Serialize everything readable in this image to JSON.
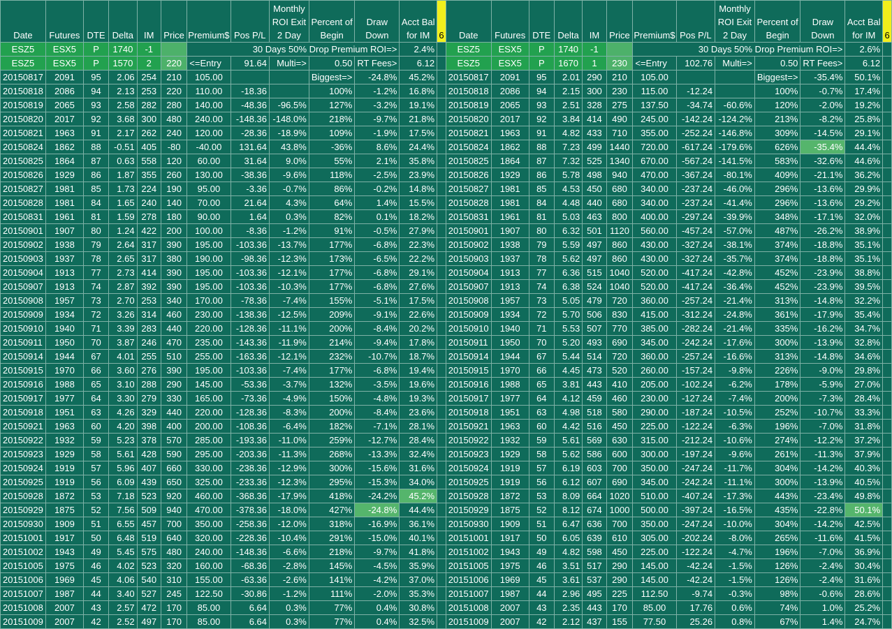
{
  "headers": [
    "Date",
    "Futures",
    "DTE",
    "Delta",
    "IM",
    "Price",
    "Premium$",
    "Pos P/L",
    "Monthly ROI Exit 2 Day",
    "Percent of Begin",
    "Draw Down",
    "Acct Bal for IM"
  ],
  "marker": "6",
  "left": {
    "row1": {
      "date": "ESZ5",
      "fut": "ESX5",
      "dte": "P",
      "delta": "1740",
      "im": "-1",
      "label": "30 Days 50% Drop Premium ROI=>",
      "roi": "2.4%"
    },
    "row2": {
      "date": "ESZ5",
      "fut": "ESX5",
      "dte": "P",
      "delta": "1570",
      "im": "2",
      "price": "220",
      "entry": "<=Entry",
      "pnl": "91.64",
      "multi": "Multi=>",
      "mval": "0.50",
      "fees": "RT Fees>",
      "fval": "6.12"
    }
  },
  "right": {
    "row1": {
      "date": "ESZ5",
      "fut": "ESX5",
      "dte": "P",
      "delta": "1740",
      "im": "-1",
      "label": "30 Days 50% Drop Premium ROI=>",
      "roi": "2.6%"
    },
    "row2": {
      "date": "ESZ5",
      "fut": "ESX5",
      "dte": "P",
      "delta": "1670",
      "im": "1",
      "price": "230",
      "entry": "<=Entry",
      "pnl": "102.76",
      "multi": "Multi=>",
      "mval": "0.50",
      "fees": "RT Fees>",
      "fval": "6.12"
    }
  },
  "rows": [
    {
      "d": "20150817",
      "f": "2091",
      "dte": "95",
      "L": [
        "2.06",
        "254",
        "210",
        "105.00",
        "",
        "",
        "Biggest=>",
        "-24.8%",
        "45.2%"
      ],
      "R": [
        "2.01",
        "290",
        "210",
        "105.00",
        "",
        "",
        "Biggest=>",
        "-35.4%",
        "50.1%"
      ]
    },
    {
      "d": "20150818",
      "f": "2086",
      "dte": "94",
      "L": [
        "2.13",
        "253",
        "220",
        "110.00",
        "-18.36",
        "",
        "100%",
        "-1.2%",
        "16.8%"
      ],
      "R": [
        "2.15",
        "300",
        "230",
        "115.00",
        "-12.24",
        "",
        "100%",
        "-0.7%",
        "17.4%"
      ]
    },
    {
      "d": "20150819",
      "f": "2065",
      "dte": "93",
      "L": [
        "2.58",
        "282",
        "280",
        "140.00",
        "-48.36",
        "-96.5%",
        "127%",
        "-3.2%",
        "19.1%"
      ],
      "R": [
        "2.51",
        "328",
        "275",
        "137.50",
        "-34.74",
        "-60.6%",
        "120%",
        "-2.0%",
        "19.2%"
      ]
    },
    {
      "d": "20150820",
      "f": "2017",
      "dte": "92",
      "L": [
        "3.68",
        "300",
        "480",
        "240.00",
        "-148.36",
        "-148.0%",
        "218%",
        "-9.7%",
        "21.8%"
      ],
      "R": [
        "3.84",
        "414",
        "490",
        "245.00",
        "-142.24",
        "-124.2%",
        "213%",
        "-8.2%",
        "25.8%"
      ]
    },
    {
      "d": "20150821",
      "f": "1963",
      "dte": "91",
      "L": [
        "2.17",
        "262",
        "240",
        "120.00",
        "-28.36",
        "-18.9%",
        "109%",
        "-1.9%",
        "17.5%"
      ],
      "R": [
        "4.82",
        "433",
        "710",
        "355.00",
        "-252.24",
        "-146.8%",
        "309%",
        "-14.5%",
        "29.1%"
      ]
    },
    {
      "d": "20150824",
      "f": "1862",
      "dte": "88",
      "L": [
        "-0.51",
        "405",
        "-80",
        "-40.00",
        "131.64",
        "43.8%",
        "-36%",
        "8.6%",
        "24.4%"
      ],
      "R": [
        "7.23",
        "499",
        "1440",
        "720.00",
        "-617.24",
        "-179.6%",
        "626%",
        "-35.4%",
        "44.4%"
      ]
    },
    {
      "d": "20150825",
      "f": "1864",
      "dte": "87",
      "L": [
        "0.63",
        "558",
        "120",
        "60.00",
        "31.64",
        "9.0%",
        "55%",
        "2.1%",
        "35.8%"
      ],
      "R": [
        "7.32",
        "525",
        "1340",
        "670.00",
        "-567.24",
        "-141.5%",
        "583%",
        "-32.6%",
        "44.6%"
      ]
    },
    {
      "d": "20150826",
      "f": "1929",
      "dte": "86",
      "L": [
        "1.87",
        "355",
        "260",
        "130.00",
        "-38.36",
        "-9.6%",
        "118%",
        "-2.5%",
        "23.9%"
      ],
      "R": [
        "5.78",
        "498",
        "940",
        "470.00",
        "-367.24",
        "-80.1%",
        "409%",
        "-21.1%",
        "36.2%"
      ]
    },
    {
      "d": "20150827",
      "f": "1981",
      "dte": "85",
      "L": [
        "1.73",
        "224",
        "190",
        "95.00",
        "-3.36",
        "-0.7%",
        "86%",
        "-0.2%",
        "14.8%"
      ],
      "R": [
        "4.53",
        "450",
        "680",
        "340.00",
        "-237.24",
        "-46.0%",
        "296%",
        "-13.6%",
        "29.9%"
      ]
    },
    {
      "d": "20150828",
      "f": "1981",
      "dte": "84",
      "L": [
        "1.65",
        "240",
        "140",
        "70.00",
        "21.64",
        "4.3%",
        "64%",
        "1.4%",
        "15.5%"
      ],
      "R": [
        "4.48",
        "440",
        "680",
        "340.00",
        "-237.24",
        "-41.4%",
        "296%",
        "-13.6%",
        "29.2%"
      ]
    },
    {
      "d": "20150831",
      "f": "1961",
      "dte": "81",
      "L": [
        "1.59",
        "278",
        "180",
        "90.00",
        "1.64",
        "0.3%",
        "82%",
        "0.1%",
        "18.2%"
      ],
      "R": [
        "5.03",
        "463",
        "800",
        "400.00",
        "-297.24",
        "-39.9%",
        "348%",
        "-17.1%",
        "32.0%"
      ]
    },
    {
      "d": "20150901",
      "f": "1907",
      "dte": "80",
      "L": [
        "1.24",
        "422",
        "200",
        "100.00",
        "-8.36",
        "-1.2%",
        "91%",
        "-0.5%",
        "27.9%"
      ],
      "R": [
        "6.32",
        "501",
        "1120",
        "560.00",
        "-457.24",
        "-57.0%",
        "487%",
        "-26.2%",
        "38.9%"
      ]
    },
    {
      "d": "20150902",
      "f": "1938",
      "dte": "79",
      "L": [
        "2.64",
        "317",
        "390",
        "195.00",
        "-103.36",
        "-13.7%",
        "177%",
        "-6.8%",
        "22.3%"
      ],
      "R": [
        "5.59",
        "497",
        "860",
        "430.00",
        "-327.24",
        "-38.1%",
        "374%",
        "-18.8%",
        "35.1%"
      ]
    },
    {
      "d": "20150903",
      "f": "1937",
      "dte": "78",
      "L": [
        "2.65",
        "317",
        "380",
        "190.00",
        "-98.36",
        "-12.3%",
        "173%",
        "-6.5%",
        "22.2%"
      ],
      "R": [
        "5.62",
        "497",
        "860",
        "430.00",
        "-327.24",
        "-35.7%",
        "374%",
        "-18.8%",
        "35.1%"
      ]
    },
    {
      "d": "20150904",
      "f": "1913",
      "dte": "77",
      "L": [
        "2.73",
        "414",
        "390",
        "195.00",
        "-103.36",
        "-12.1%",
        "177%",
        "-6.8%",
        "29.1%"
      ],
      "R": [
        "6.36",
        "515",
        "1040",
        "520.00",
        "-417.24",
        "-42.8%",
        "452%",
        "-23.9%",
        "38.8%"
      ]
    },
    {
      "d": "20150907",
      "f": "1913",
      "dte": "74",
      "L": [
        "2.87",
        "392",
        "390",
        "195.00",
        "-103.36",
        "-10.3%",
        "177%",
        "-6.8%",
        "27.6%"
      ],
      "R": [
        "6.38",
        "524",
        "1040",
        "520.00",
        "-417.24",
        "-36.4%",
        "452%",
        "-23.9%",
        "39.5%"
      ]
    },
    {
      "d": "20150908",
      "f": "1957",
      "dte": "73",
      "L": [
        "2.70",
        "253",
        "340",
        "170.00",
        "-78.36",
        "-7.4%",
        "155%",
        "-5.1%",
        "17.5%"
      ],
      "R": [
        "5.05",
        "479",
        "720",
        "360.00",
        "-257.24",
        "-21.4%",
        "313%",
        "-14.8%",
        "32.2%"
      ]
    },
    {
      "d": "20150909",
      "f": "1934",
      "dte": "72",
      "L": [
        "3.26",
        "314",
        "460",
        "230.00",
        "-138.36",
        "-12.5%",
        "209%",
        "-9.1%",
        "22.6%"
      ],
      "R": [
        "5.70",
        "506",
        "830",
        "415.00",
        "-312.24",
        "-24.8%",
        "361%",
        "-17.9%",
        "35.4%"
      ]
    },
    {
      "d": "20150910",
      "f": "1940",
      "dte": "71",
      "L": [
        "3.39",
        "283",
        "440",
        "220.00",
        "-128.36",
        "-11.1%",
        "200%",
        "-8.4%",
        "20.2%"
      ],
      "R": [
        "5.53",
        "507",
        "770",
        "385.00",
        "-282.24",
        "-21.4%",
        "335%",
        "-16.2%",
        "34.7%"
      ]
    },
    {
      "d": "20150911",
      "f": "1950",
      "dte": "70",
      "L": [
        "3.87",
        "246",
        "470",
        "235.00",
        "-143.36",
        "-11.9%",
        "214%",
        "-9.4%",
        "17.8%"
      ],
      "R": [
        "5.20",
        "493",
        "690",
        "345.00",
        "-242.24",
        "-17.6%",
        "300%",
        "-13.9%",
        "32.8%"
      ]
    },
    {
      "d": "20150914",
      "f": "1944",
      "dte": "67",
      "L": [
        "4.01",
        "255",
        "510",
        "255.00",
        "-163.36",
        "-12.1%",
        "232%",
        "-10.7%",
        "18.7%"
      ],
      "R": [
        "5.44",
        "514",
        "720",
        "360.00",
        "-257.24",
        "-16.6%",
        "313%",
        "-14.8%",
        "34.6%"
      ]
    },
    {
      "d": "20150915",
      "f": "1970",
      "dte": "66",
      "L": [
        "3.60",
        "276",
        "390",
        "195.00",
        "-103.36",
        "-7.4%",
        "177%",
        "-6.8%",
        "19.4%"
      ],
      "R": [
        "4.45",
        "473",
        "520",
        "260.00",
        "-157.24",
        "-9.8%",
        "226%",
        "-9.0%",
        "29.8%"
      ]
    },
    {
      "d": "20150916",
      "f": "1988",
      "dte": "65",
      "L": [
        "3.10",
        "288",
        "290",
        "145.00",
        "-53.36",
        "-3.7%",
        "132%",
        "-3.5%",
        "19.6%"
      ],
      "R": [
        "3.81",
        "443",
        "410",
        "205.00",
        "-102.24",
        "-6.2%",
        "178%",
        "-5.9%",
        "27.0%"
      ]
    },
    {
      "d": "20150917",
      "f": "1977",
      "dte": "64",
      "L": [
        "3.30",
        "279",
        "330",
        "165.00",
        "-73.36",
        "-4.9%",
        "150%",
        "-4.8%",
        "19.3%"
      ],
      "R": [
        "4.12",
        "459",
        "460",
        "230.00",
        "-127.24",
        "-7.4%",
        "200%",
        "-7.3%",
        "28.4%"
      ]
    },
    {
      "d": "20150918",
      "f": "1951",
      "dte": "63",
      "L": [
        "4.26",
        "329",
        "440",
        "220.00",
        "-128.36",
        "-8.3%",
        "200%",
        "-8.4%",
        "23.6%"
      ],
      "R": [
        "4.98",
        "518",
        "580",
        "290.00",
        "-187.24",
        "-10.5%",
        "252%",
        "-10.7%",
        "33.3%"
      ]
    },
    {
      "d": "20150921",
      "f": "1963",
      "dte": "60",
      "L": [
        "4.20",
        "398",
        "400",
        "200.00",
        "-108.36",
        "-6.4%",
        "182%",
        "-7.1%",
        "28.1%"
      ],
      "R": [
        "4.42",
        "516",
        "450",
        "225.00",
        "-122.24",
        "-6.3%",
        "196%",
        "-7.0%",
        "31.8%"
      ]
    },
    {
      "d": "20150922",
      "f": "1932",
      "dte": "59",
      "L": [
        "5.23",
        "378",
        "570",
        "285.00",
        "-193.36",
        "-11.0%",
        "259%",
        "-12.7%",
        "28.4%"
      ],
      "R": [
        "5.61",
        "569",
        "630",
        "315.00",
        "-212.24",
        "-10.6%",
        "274%",
        "-12.2%",
        "37.2%"
      ]
    },
    {
      "d": "20150923",
      "f": "1929",
      "dte": "58",
      "L": [
        "5.61",
        "428",
        "590",
        "295.00",
        "-203.36",
        "-11.3%",
        "268%",
        "-13.3%",
        "32.4%"
      ],
      "R": [
        "5.62",
        "586",
        "600",
        "300.00",
        "-197.24",
        "-9.6%",
        "261%",
        "-11.3%",
        "37.9%"
      ]
    },
    {
      "d": "20150924",
      "f": "1919",
      "dte": "57",
      "L": [
        "5.96",
        "407",
        "660",
        "330.00",
        "-238.36",
        "-12.9%",
        "300%",
        "-15.6%",
        "31.6%"
      ],
      "R": [
        "6.19",
        "603",
        "700",
        "350.00",
        "-247.24",
        "-11.7%",
        "304%",
        "-14.2%",
        "40.3%"
      ]
    },
    {
      "d": "20150925",
      "f": "1919",
      "dte": "56",
      "L": [
        "6.09",
        "439",
        "650",
        "325.00",
        "-233.36",
        "-12.3%",
        "295%",
        "-15.3%",
        "34.0%"
      ],
      "R": [
        "6.12",
        "607",
        "690",
        "345.00",
        "-242.24",
        "-11.1%",
        "300%",
        "-13.9%",
        "40.5%"
      ]
    },
    {
      "d": "20150928",
      "f": "1872",
      "dte": "53",
      "L": [
        "7.18",
        "523",
        "920",
        "460.00",
        "-368.36",
        "-17.9%",
        "418%",
        "-24.2%",
        "45.2%"
      ],
      "R": [
        "8.09",
        "664",
        "1020",
        "510.00",
        "-407.24",
        "-17.3%",
        "443%",
        "-23.4%",
        "49.8%"
      ]
    },
    {
      "d": "20150929",
      "f": "1875",
      "dte": "52",
      "L": [
        "7.56",
        "509",
        "940",
        "470.00",
        "-378.36",
        "-18.0%",
        "427%",
        "-24.8%",
        "44.4%"
      ],
      "R": [
        "8.12",
        "674",
        "1000",
        "500.00",
        "-397.24",
        "-16.5%",
        "435%",
        "-22.8%",
        "50.1%"
      ]
    },
    {
      "d": "20150930",
      "f": "1909",
      "dte": "51",
      "L": [
        "6.55",
        "457",
        "700",
        "350.00",
        "-258.36",
        "-12.0%",
        "318%",
        "-16.9%",
        "36.1%"
      ],
      "R": [
        "6.47",
        "636",
        "700",
        "350.00",
        "-247.24",
        "-10.0%",
        "304%",
        "-14.2%",
        "42.5%"
      ]
    },
    {
      "d": "20151001",
      "f": "1917",
      "dte": "50",
      "L": [
        "6.48",
        "519",
        "640",
        "320.00",
        "-228.36",
        "-10.4%",
        "291%",
        "-15.0%",
        "40.1%"
      ],
      "R": [
        "6.05",
        "639",
        "610",
        "305.00",
        "-202.24",
        "-8.0%",
        "265%",
        "-11.6%",
        "41.5%"
      ]
    },
    {
      "d": "20151002",
      "f": "1943",
      "dte": "49",
      "L": [
        "5.45",
        "575",
        "480",
        "240.00",
        "-148.36",
        "-6.6%",
        "218%",
        "-9.7%",
        "41.8%"
      ],
      "R": [
        "4.82",
        "598",
        "450",
        "225.00",
        "-122.24",
        "-4.7%",
        "196%",
        "-7.0%",
        "36.9%"
      ]
    },
    {
      "d": "20151005",
      "f": "1975",
      "dte": "46",
      "L": [
        "4.02",
        "523",
        "320",
        "160.00",
        "-68.36",
        "-2.8%",
        "145%",
        "-4.5%",
        "35.9%"
      ],
      "R": [
        "3.51",
        "517",
        "290",
        "145.00",
        "-42.24",
        "-1.5%",
        "126%",
        "-2.4%",
        "30.4%"
      ]
    },
    {
      "d": "20151006",
      "f": "1969",
      "dte": "45",
      "L": [
        "4.06",
        "540",
        "310",
        "155.00",
        "-63.36",
        "-2.6%",
        "141%",
        "-4.2%",
        "37.0%"
      ],
      "R": [
        "3.61",
        "537",
        "290",
        "145.00",
        "-42.24",
        "-1.5%",
        "126%",
        "-2.4%",
        "31.6%"
      ]
    },
    {
      "d": "20151007",
      "f": "1987",
      "dte": "44",
      "L": [
        "3.40",
        "527",
        "245",
        "122.50",
        "-30.86",
        "-1.2%",
        "111%",
        "-2.0%",
        "35.3%"
      ],
      "R": [
        "2.96",
        "495",
        "225",
        "112.50",
        "-9.74",
        "-0.3%",
        "98%",
        "-0.6%",
        "28.6%"
      ]
    },
    {
      "d": "20151008",
      "f": "2007",
      "dte": "43",
      "L": [
        "2.57",
        "472",
        "170",
        "85.00",
        "6.64",
        "0.3%",
        "77%",
        "0.4%",
        "30.8%"
      ],
      "R": [
        "2.35",
        "443",
        "170",
        "85.00",
        "17.76",
        "0.6%",
        "74%",
        "1.0%",
        "25.2%"
      ]
    },
    {
      "d": "20151009",
      "f": "2007",
      "dte": "42",
      "L": [
        "2.52",
        "497",
        "170",
        "85.00",
        "6.64",
        "0.3%",
        "77%",
        "0.4%",
        "32.5%"
      ],
      "R": [
        "2.12",
        "437",
        "155",
        "77.50",
        "25.26",
        "0.8%",
        "67%",
        "1.4%",
        "24.7%"
      ]
    }
  ]
}
